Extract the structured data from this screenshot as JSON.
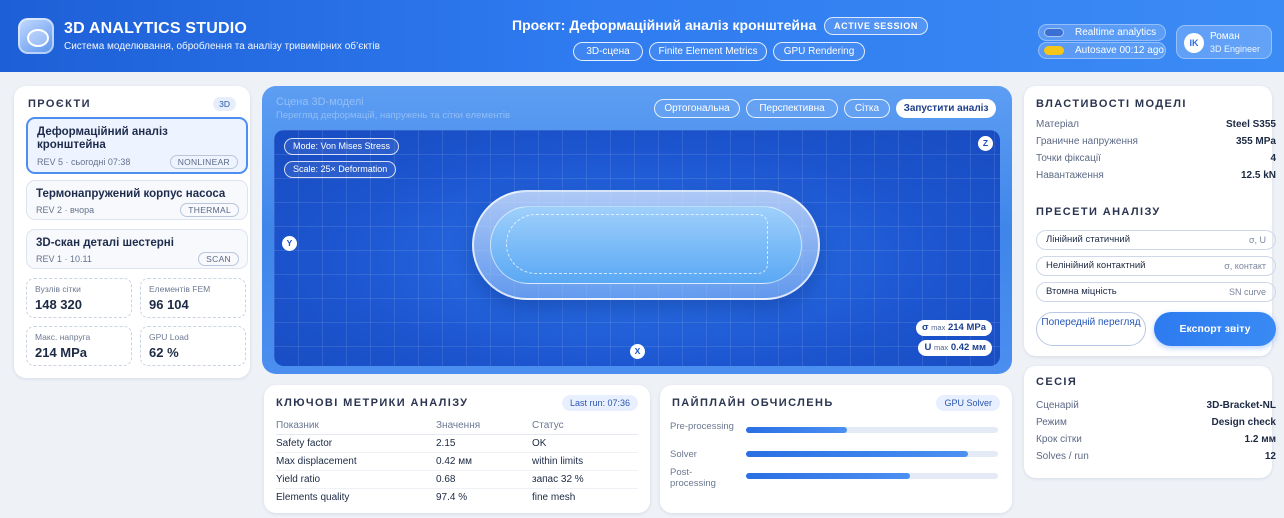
{
  "app": {
    "title": "3D ANALYTICS STUDIO",
    "subtitle": "Система моделювання, оброблення та аналізу тривимірних об’єктів"
  },
  "project": {
    "title": "Проєкт: Деформаційний аналіз кронштейна",
    "badge": "ACTIVE SESSION",
    "tabs": [
      {
        "label": "3D-сцена"
      },
      {
        "label": "Finite Element Metrics"
      },
      {
        "label": "GPU Rendering"
      }
    ]
  },
  "status": {
    "realtime": "Realtime analytics",
    "autosave": "Autosave 00:12 ago",
    "toggle_on_color": "#f5c518",
    "toggle_off_color": "#3a6fd4"
  },
  "user": {
    "initials": "IK",
    "name": "Роман",
    "role": "3D Engineer"
  },
  "sidebar": {
    "title": "ПРОЄКТИ",
    "badge": "3D",
    "projects": [
      {
        "name": "Деформаційний аналіз кронштейна",
        "meta": "REV 5 · сьогодні 07:38",
        "tag": "NONLINEAR"
      },
      {
        "name": "Термонапружений корпус насоса",
        "meta": "REV 2 · вчора",
        "tag": "THERMAL"
      },
      {
        "name": "3D-скан деталі шестерні",
        "meta": "REV 1 · 10.11",
        "tag": "SCAN"
      }
    ],
    "stats": [
      {
        "label": "Вузлів сітки",
        "value": "148 320"
      },
      {
        "label": "Елементів FEM",
        "value": "96 104"
      },
      {
        "label": "Макс. напруга",
        "value": "214 MPa"
      },
      {
        "label": "GPU Load",
        "value": "62 %"
      }
    ]
  },
  "viewport": {
    "ghost_title": "Сцена 3D-моделі",
    "ghost_sub": "Перегляд деформацій, напружень та сітки елементів",
    "buttons": [
      {
        "label": "Ортогональна"
      },
      {
        "label": "Перспективна"
      },
      {
        "label": "Сітка"
      },
      {
        "label": "Запустити аналіз"
      }
    ],
    "mode": "Mode: Von Mises Stress",
    "scale": "Scale: 25× Deformation",
    "axes": {
      "z": "Z",
      "y": "Y",
      "x": "X"
    },
    "readouts": [
      {
        "sym": "σ",
        "sub": "max",
        "value": "214 MPa"
      },
      {
        "sym": "U",
        "sub": "max",
        "value": "0.42 мм"
      }
    ]
  },
  "metrics": {
    "title": "КЛЮЧОВІ МЕТРИКИ АНАЛІЗУ",
    "last_run": "Last run: 07:36",
    "headers": [
      "Показник",
      "Значення",
      "Статус"
    ],
    "rows": [
      {
        "name": "Safety factor",
        "value": "2.15",
        "status": "OK"
      },
      {
        "name": "Max displacement",
        "value": "0.42 мм",
        "status": "within limits"
      },
      {
        "name": "Yield ratio",
        "value": "0.68",
        "status": "запас 32 %"
      },
      {
        "name": "Elements quality",
        "value": "97.4 %",
        "status": "fine mesh"
      }
    ]
  },
  "pipeline": {
    "title": "ПАЙПЛАЙН ОБЧИСЛЕНЬ",
    "badge": "GPU Solver",
    "stages": [
      {
        "label": "Pre-processing",
        "progress": 0.4
      },
      {
        "label": "Solver",
        "progress": 0.88
      },
      {
        "label": "Post-processing",
        "progress": 0.65
      }
    ]
  },
  "properties": {
    "title": "ВЛАСТИВОСТІ МОДЕЛІ",
    "items": [
      {
        "key": "Матеріал",
        "value": "Steel S355"
      },
      {
        "key": "Граничне напруження",
        "value": "355 MPa"
      },
      {
        "key": "Точки фіксації",
        "value": "4"
      },
      {
        "key": "Навантаження",
        "value": "12.5 kN"
      }
    ],
    "presets_title": "ПРЕСЕТИ АНАЛІЗУ",
    "presets": [
      {
        "label": "Лінійний статичний",
        "hint": "σ, U"
      },
      {
        "label": "Нелінійний контактний",
        "hint": "σ, контакт"
      },
      {
        "label": "Втомна міцність",
        "hint": "SN curve"
      }
    ],
    "preview_button": "Попередній перегляд",
    "export_button": "Експорт звіту"
  },
  "session": {
    "title": "СЕСІЯ",
    "items": [
      {
        "key": "Сценарій",
        "value": "3D-Bracket-NL"
      },
      {
        "key": "Режим",
        "value": "Design check"
      },
      {
        "key": "Крок сітки",
        "value": "1.2 мм"
      },
      {
        "key": "Solves / run",
        "value": "12"
      }
    ]
  }
}
